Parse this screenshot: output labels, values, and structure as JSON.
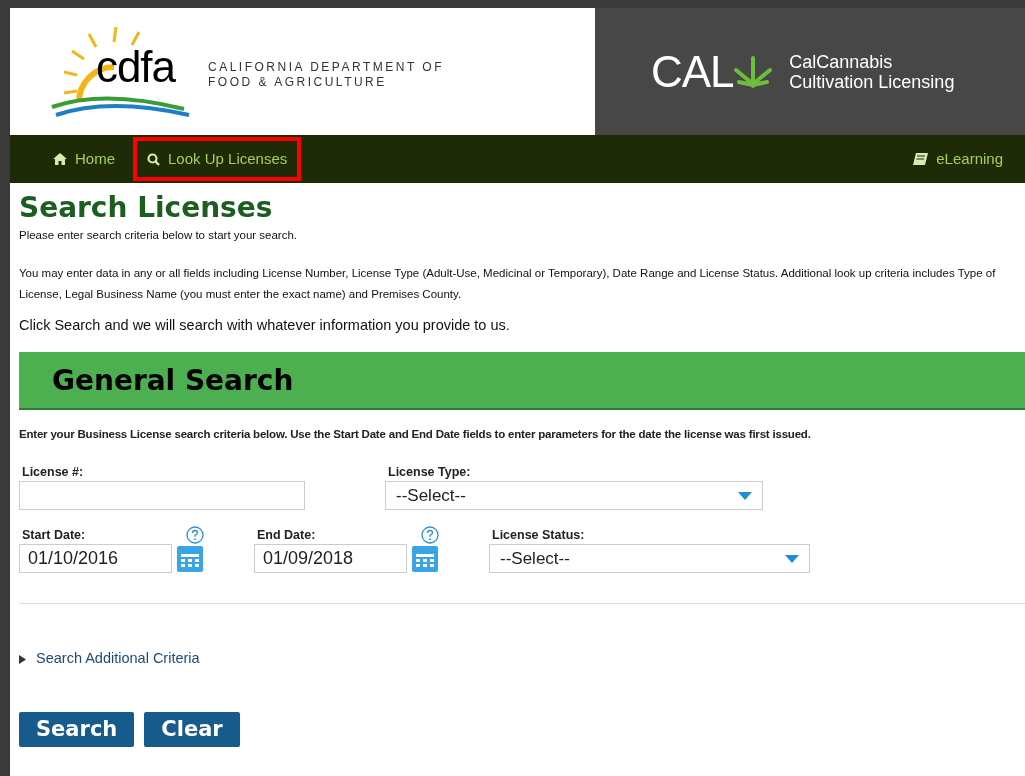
{
  "header": {
    "logo_text": "cdfa",
    "logo_lines": [
      "CALIFORNIA DEPARTMENT OF",
      "FOOD & AGRICULTURE"
    ],
    "brand_text": "CAL",
    "brand_lines": [
      "CalCannabis",
      "Cultivation Licensing"
    ]
  },
  "nav": {
    "items": [
      {
        "label": "Home",
        "kind": "home",
        "highlighted": false
      },
      {
        "label": "Look Up Licenses",
        "kind": "search",
        "highlighted": true
      }
    ],
    "right_item": {
      "label": "eLearning",
      "kind": "book"
    }
  },
  "page": {
    "title": "Search Licenses",
    "intro": "Please enter search criteria below to start your search.",
    "description": "You may enter data in any or all fields including License Number, License Type (Adult-Use, Medicinal or Temporary), Date Range and License Status. Additional look up criteria includes Type of License, Legal Business Name (you must enter the exact name) and Premises County.",
    "instruction": "Click Search and we will search with whatever information you provide to us."
  },
  "general_search": {
    "heading": "General Search",
    "hint": "Enter your Business License search criteria below.  Use the Start Date and End Date fields to enter parameters for the date the license was first issued.",
    "rows": [
      [
        {
          "label": "License #:",
          "kind": "text",
          "help": false
        },
        {
          "label": "License Type:",
          "kind": "select",
          "value": "--Select--",
          "help": false
        }
      ],
      [
        {
          "label": "Start Date:",
          "kind": "date",
          "value": "01/10/2016",
          "help": true
        },
        {
          "label": "End Date:",
          "kind": "date",
          "value": "01/09/2018",
          "help": true
        },
        {
          "label": "License Status:",
          "kind": "select",
          "value": "--Select--",
          "help": false
        }
      ]
    ]
  },
  "additional_criteria": {
    "label": "Search Additional Criteria",
    "expanded": false
  },
  "buttons": [
    "Search",
    "Clear"
  ]
}
